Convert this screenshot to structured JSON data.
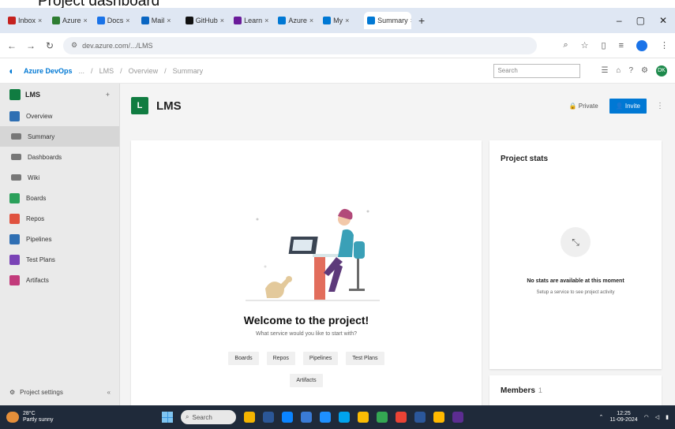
{
  "slide_title": "Project dashboard",
  "browser": {
    "tabs": [
      {
        "label": "Inbox",
        "color": "#c5221f"
      },
      {
        "label": "Azure",
        "color": "#2e7d32"
      },
      {
        "label": "Docs",
        "color": "#1a73e8"
      },
      {
        "label": "Mail",
        "color": "#0a66c2"
      },
      {
        "label": "GitHub",
        "color": "#111111"
      },
      {
        "label": "Learn",
        "color": "#6a1b9a"
      },
      {
        "label": "Azure",
        "color": "#0078d4"
      },
      {
        "label": "My",
        "color": "#0078d4"
      },
      {
        "label": "Summary",
        "color": "#0078d4",
        "active": true
      }
    ],
    "new_tab": "+",
    "url": "dev.azure.com/.../LMS",
    "win_min": "–",
    "win_max": "▢",
    "win_close": "✕"
  },
  "ado": {
    "brand": "Azure DevOps",
    "crumbs": [
      "...",
      "LMS",
      "Overview",
      "Summary"
    ],
    "search_placeholder": "Search",
    "avatar_initials": "DK"
  },
  "sidebar": {
    "project": "LMS",
    "add": "+",
    "items": [
      {
        "label": "Overview",
        "color": "#2f6fb3"
      },
      {
        "label": "Summary",
        "sub": true,
        "selected": true
      },
      {
        "label": "Dashboards",
        "sub": true
      },
      {
        "label": "Wiki",
        "sub": true
      },
      {
        "label": "Boards",
        "color": "#2aa05a"
      },
      {
        "label": "Repos",
        "color": "#e0523f"
      },
      {
        "label": "Pipelines",
        "color": "#2f6fb3"
      },
      {
        "label": "Test Plans",
        "color": "#7a43b6"
      },
      {
        "label": "Artifacts",
        "color": "#c23b7b"
      }
    ],
    "settings": "Project settings",
    "collapse": "«"
  },
  "main": {
    "project_initial": "L",
    "project_name": "LMS",
    "private_label": "Private",
    "invite_label": "Invite",
    "more": "⋮",
    "welcome_title": "Welcome to the project!",
    "welcome_sub": "What service would you like to start with?",
    "chips": [
      "Boards",
      "Repos",
      "Pipelines",
      "Test Plans"
    ],
    "chip_last": "Artifacts",
    "stats_title": "Project stats",
    "stats_msg": "No stats are available at this moment",
    "stats_sub": "Setup a service to see project activity",
    "members_title": "Members",
    "members_count": "1"
  },
  "taskbar": {
    "temp": "28°C",
    "weather": "Partly sunny",
    "search_label": "Search",
    "time": "12:25",
    "date": "11-09-2024",
    "apps": [
      "#f4b400",
      "#2b5797",
      "#0a84ff",
      "#3a7bd5",
      "#1e90ff",
      "#00a4ef",
      "#fbbc04",
      "#34a853",
      "#ea4335",
      "#2b579a",
      "#ffb900",
      "#5c2d91"
    ]
  }
}
